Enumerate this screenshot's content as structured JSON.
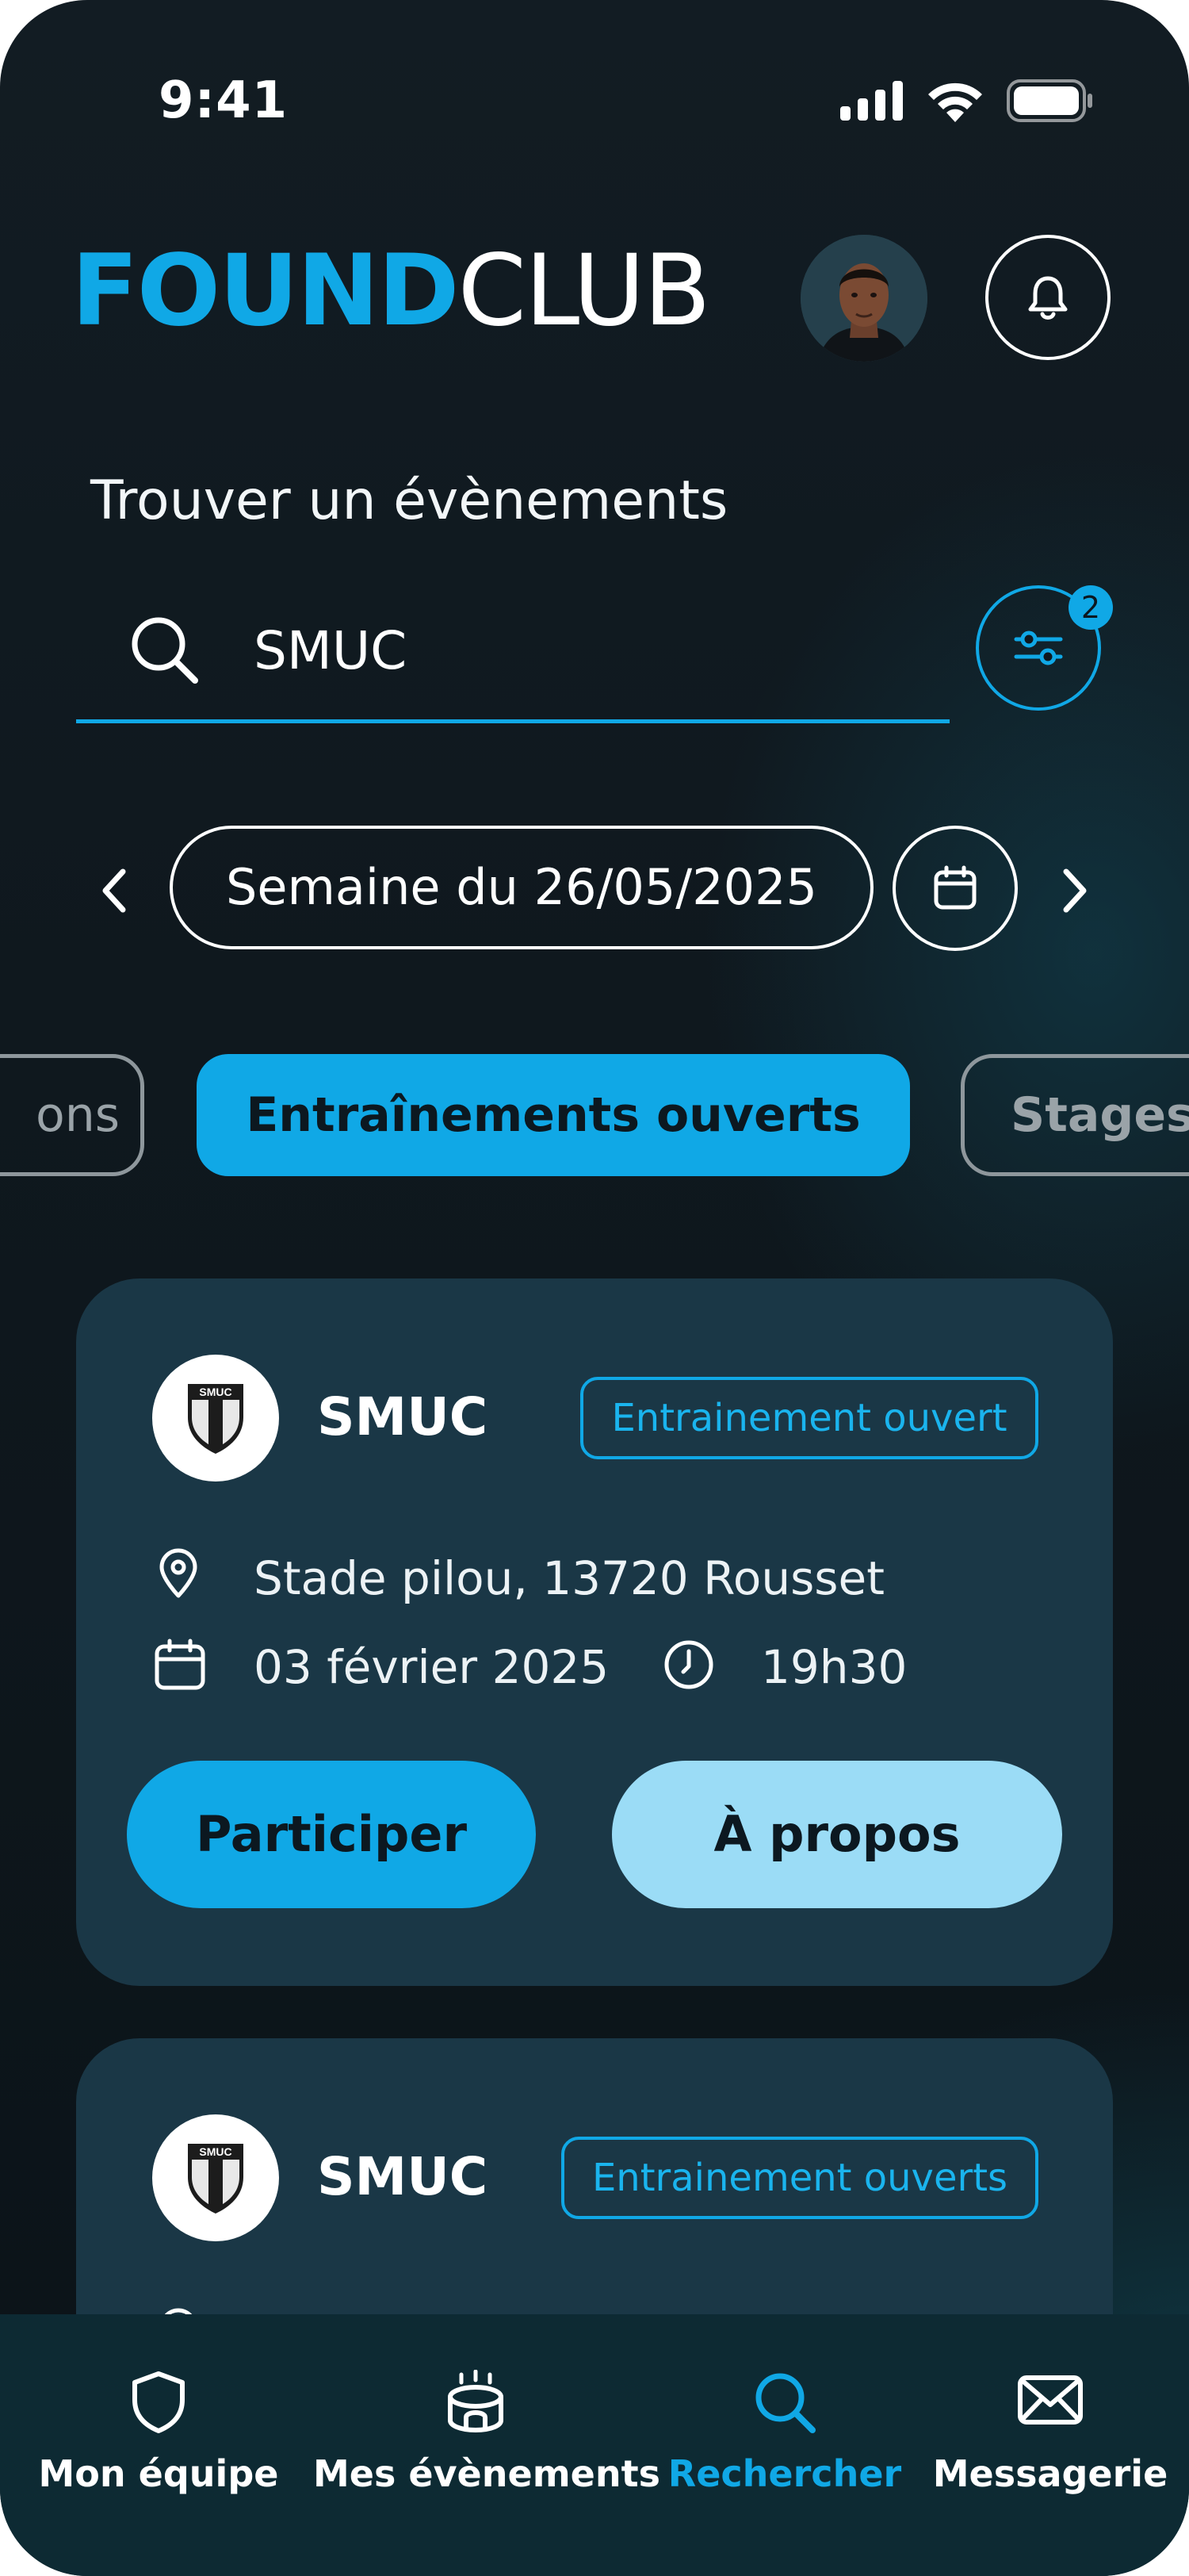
{
  "status_bar": {
    "time": "9:41"
  },
  "header": {
    "logo_part1": "FOUND",
    "logo_part2": "CLUB"
  },
  "page": {
    "title": "Trouver un évènements"
  },
  "search": {
    "value": "SMUC",
    "filter_count": "2"
  },
  "week": {
    "label": "Semaine du 26/05/2025"
  },
  "chips": [
    "ons",
    "Entraînements ouverts",
    "Stages"
  ],
  "events": [
    {
      "club": "SMUC",
      "logo_text": "SMUC",
      "tag": "Entrainement ouvert",
      "location": "Stade pilou, 13720 Rousset",
      "date": "03 février 2025",
      "time": "19h30",
      "primary_button": "Participer",
      "secondary_button": "À propos"
    },
    {
      "club": "SMUC",
      "logo_text": "SMUC",
      "tag": "Entrainement ouverts"
    }
  ],
  "nav": [
    {
      "label": "Mon équipe",
      "icon": "shield-icon"
    },
    {
      "label": "Mes évènements",
      "icon": "stadium-icon"
    },
    {
      "label": "Rechercher",
      "icon": "search-icon",
      "active": true
    },
    {
      "label": "Messagerie",
      "icon": "mail-icon"
    }
  ],
  "colors": {
    "accent": "#10a8e6",
    "card": "#1a3746",
    "background": "#101a20",
    "nav": "#0d2a33",
    "secondary_button": "#9bdcf6"
  }
}
